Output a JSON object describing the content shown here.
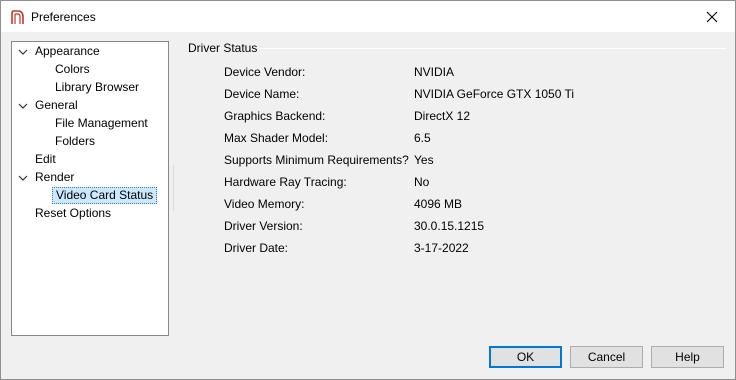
{
  "window": {
    "title": "Preferences",
    "close_glyph": "✕"
  },
  "tree": {
    "items": [
      {
        "label": "Appearance",
        "level": 0,
        "expanded": true
      },
      {
        "label": "Colors",
        "level": 1
      },
      {
        "label": "Library Browser",
        "level": 1
      },
      {
        "label": "General",
        "level": 0,
        "expanded": true
      },
      {
        "label": "File Management",
        "level": 1
      },
      {
        "label": "Folders",
        "level": 1
      },
      {
        "label": "Edit",
        "level": 0
      },
      {
        "label": "Render",
        "level": 0,
        "expanded": true
      },
      {
        "label": "Video Card Status",
        "level": 1,
        "selected": true
      },
      {
        "label": "Reset Options",
        "level": 0
      }
    ]
  },
  "driver_status": {
    "group_title": "Driver Status",
    "rows": [
      {
        "label": "Device Vendor:",
        "value": "NVIDIA"
      },
      {
        "label": "Device Name:",
        "value": "NVIDIA GeForce GTX 1050 Ti"
      },
      {
        "label": "Graphics Backend:",
        "value": "DirectX 12"
      },
      {
        "label": "Max Shader Model:",
        "value": "6.5"
      },
      {
        "label": "Supports Minimum Requirements?",
        "value": "Yes"
      },
      {
        "label": "Hardware Ray Tracing:",
        "value": "No"
      },
      {
        "label": "Video Memory:",
        "value": "4096 MB"
      },
      {
        "label": "Driver Version:",
        "value": "30.0.15.1215"
      },
      {
        "label": "Driver Date:",
        "value": "3-17-2022"
      }
    ]
  },
  "buttons": {
    "ok": "OK",
    "cancel": "Cancel",
    "help": "Help"
  },
  "colors": {
    "selection_bg": "#cce8ff",
    "default_button_border": "#0078d7",
    "app_icon": "#c0392b"
  },
  "icons": {
    "app": "app-logo-icon",
    "close": "close-icon",
    "expander": "chevron-down-icon"
  }
}
